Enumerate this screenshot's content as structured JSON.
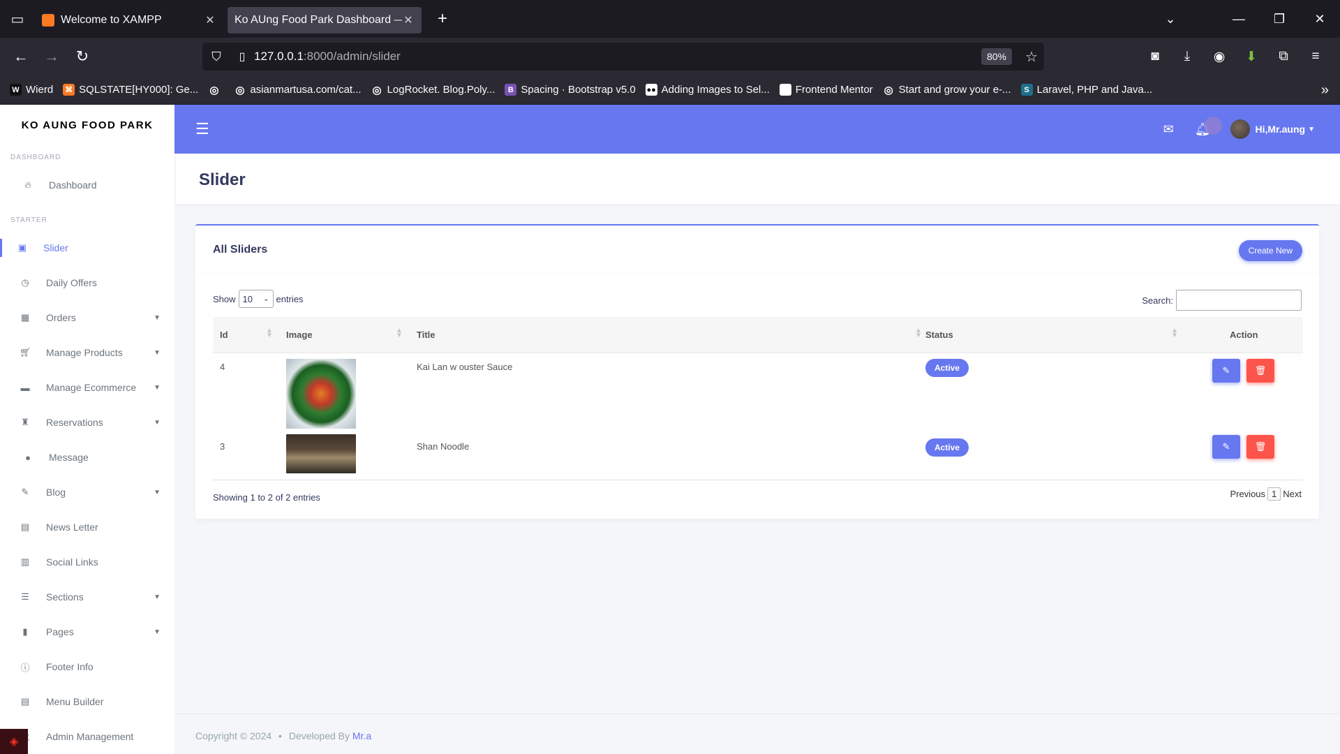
{
  "browser": {
    "tabs": [
      {
        "title": "Welcome to XAMPP",
        "favicon_color": "#fb7a24",
        "close": "✕"
      },
      {
        "title": "Ko AUng Food Park Dashboard — S",
        "favicon_color": "",
        "close": "✕"
      }
    ],
    "new_tab": "+",
    "url_host": "127.0.0.1",
    "url_path": ":8000/admin/slider",
    "zoom": "80%",
    "bookmarks": [
      {
        "label": "Wierd",
        "icon": "W",
        "icon_color": "#111"
      },
      {
        "label": "SQLSTATE[HY000]: Ge...",
        "icon": "⌘",
        "icon_color": "#fb7a24"
      },
      {
        "label": "",
        "icon": "globe-icon",
        "icon_color": ""
      },
      {
        "label": "asianmartusa.com/cat...",
        "icon": "globe-icon",
        "icon_color": ""
      },
      {
        "label": "LogRocket. Blog.Poly...",
        "icon": "globe-icon",
        "icon_color": ""
      },
      {
        "label": "Spacing · Bootstrap v5.0",
        "icon": "B",
        "icon_color": "#7952b3"
      },
      {
        "label": "Adding Images to Sel...",
        "icon": "M",
        "icon_color": "#000"
      },
      {
        "label": "Frontend Mentor",
        "icon": "",
        "icon_color": "#ffffff"
      },
      {
        "label": "Start and grow your e-...",
        "icon": "globe-icon",
        "icon_color": ""
      },
      {
        "label": "Laravel, PHP and Java...",
        "icon": "S",
        "icon_color": "#1f6f8b"
      }
    ]
  },
  "sidebar": {
    "brand": "KO AUNG FOOD PARK",
    "header_dashboard": "DASHBOARD",
    "header_starter": "STARTER",
    "items": [
      {
        "label": "Dashboard",
        "icon": "fire-icon",
        "caret": false
      },
      {
        "label": "Slider",
        "icon": "image-icon",
        "caret": false,
        "active": true
      },
      {
        "label": "Daily Offers",
        "icon": "clock-icon",
        "caret": false
      },
      {
        "label": "Orders",
        "icon": "box-icon",
        "caret": true
      },
      {
        "label": "Manage Products",
        "icon": "cart-icon",
        "caret": true
      },
      {
        "label": "Manage Ecommerce",
        "icon": "store-icon",
        "caret": true
      },
      {
        "label": "Reservations",
        "icon": "chair-icon",
        "caret": true
      },
      {
        "label": "Message",
        "icon": "chat-icon",
        "caret": false
      },
      {
        "label": "Blog",
        "icon": "blog-icon",
        "caret": true
      },
      {
        "label": "News Letter",
        "icon": "newsletter-icon",
        "caret": false
      },
      {
        "label": "Social Links",
        "icon": "link-icon",
        "caret": false
      },
      {
        "label": "Sections",
        "icon": "bars-icon",
        "caret": true
      },
      {
        "label": "Pages",
        "icon": "file-icon",
        "caret": true
      },
      {
        "label": "Footer Info",
        "icon": "info-icon",
        "caret": false
      },
      {
        "label": "Menu Builder",
        "icon": "list-icon",
        "caret": false
      },
      {
        "label": "Admin Management",
        "icon": "users-icon",
        "caret": false
      }
    ]
  },
  "topbar": {
    "user_name": "Hi,Mr.aung"
  },
  "page": {
    "title": "Slider"
  },
  "card": {
    "title": "All Sliders",
    "create_label": "Create New",
    "show_label": "Show",
    "entries_value": "10",
    "entries_label": "entries",
    "search_label": "Search:",
    "columns": {
      "id": "Id",
      "image": "Image",
      "title": "Title",
      "status": "Status",
      "action": "Action"
    },
    "rows": [
      {
        "id": "4",
        "title": "Kai Lan w ouster Sauce",
        "status": "Active"
      },
      {
        "id": "3",
        "title": "Shan Noodle",
        "status": "Active"
      }
    ],
    "info": "Showing 1 to 2 of 2 entries",
    "prev_label": "Previous",
    "page_number": "1",
    "next_label": "Next"
  },
  "footer": {
    "copyright": "Copyright © 2024",
    "separator": "•",
    "developed_by": "Developed By",
    "author": "Mr.a"
  },
  "colors": {
    "primary": "#6777ef",
    "danger": "#fc544b"
  }
}
